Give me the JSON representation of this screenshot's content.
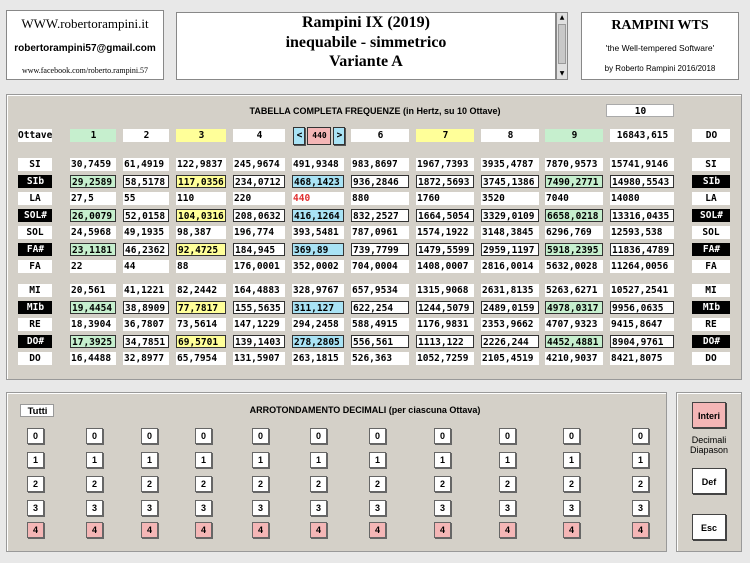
{
  "info": {
    "website": "WWW.robertorampini.it",
    "email": "robertorampini57@gmail.com",
    "facebook": "www.facebook.com/roberto.rampini.57"
  },
  "header": {
    "line1": "Rampini IX (2019)",
    "line2": "inequabile - simmetrico",
    "line3": "Variante A"
  },
  "wts": {
    "title": "RAMPINI WTS",
    "subtitle": "'the Well-tempered Software'",
    "author": "by Roberto Rampini 2016/2018"
  },
  "table": {
    "title": "TABELLA COMPLETA FREQUENZE (in Hertz, su 10 Ottave)",
    "octave_count": "10",
    "ottave_label": "Ottave",
    "octaves": [
      "1",
      "2",
      "3",
      "4",
      "",
      "6",
      "7",
      "8",
      "9"
    ],
    "diapason": {
      "left": "<",
      "value": "440",
      "right": ">"
    },
    "header_total": "16843,615",
    "header_note": "DO",
    "rows": [
      {
        "note": "SI",
        "style": "w",
        "values": [
          "30,7459",
          "61,4919",
          "122,9837",
          "245,9674",
          "491,9348",
          "983,8697",
          "1967,7393",
          "3935,4787",
          "7870,9573",
          "15741,9146"
        ]
      },
      {
        "note": "SIb",
        "style": "k",
        "values": [
          "29,2589",
          "58,5178",
          "117,0356",
          "234,0712",
          "468,1423",
          "936,2846",
          "1872,5693",
          "3745,1386",
          "7490,2771",
          "14980,5543"
        ]
      },
      {
        "note": "LA",
        "style": "w",
        "values": [
          "27,5",
          "55",
          "110",
          "220",
          "440",
          "880",
          "1760",
          "3520",
          "7040",
          "14080"
        ]
      },
      {
        "note": "SOL#",
        "style": "k",
        "values": [
          "26,0079",
          "52,0158",
          "104,0316",
          "208,0632",
          "416,1264",
          "832,2527",
          "1664,5054",
          "3329,0109",
          "6658,0218",
          "13316,0435"
        ]
      },
      {
        "note": "SOL",
        "style": "w",
        "values": [
          "24,5968",
          "49,1935",
          "98,387",
          "196,774",
          "393,5481",
          "787,0961",
          "1574,1922",
          "3148,3845",
          "6296,769",
          "12593,538"
        ]
      },
      {
        "note": "FA#",
        "style": "k",
        "values": [
          "23,1181",
          "46,2362",
          "92,4725",
          "184,945",
          "369,89",
          "739,7799",
          "1479,5599",
          "2959,1197",
          "5918,2395",
          "11836,4789"
        ]
      },
      {
        "note": "FA",
        "style": "w",
        "values": [
          "22",
          "44",
          "88",
          "176,0001",
          "352,0002",
          "704,0004",
          "1408,0007",
          "2816,0014",
          "5632,0028",
          "11264,0056"
        ]
      },
      {
        "note": "MI",
        "style": "w",
        "values": [
          "20,561",
          "41,1221",
          "82,2442",
          "164,4883",
          "328,9767",
          "657,9534",
          "1315,9068",
          "2631,8135",
          "5263,6271",
          "10527,2541"
        ]
      },
      {
        "note": "MIb",
        "style": "k",
        "values": [
          "19,4454",
          "38,8909",
          "77,7817",
          "155,5635",
          "311,127",
          "622,254",
          "1244,5079",
          "2489,0159",
          "4978,0317",
          "9956,0635"
        ]
      },
      {
        "note": "RE",
        "style": "w",
        "values": [
          "18,3904",
          "36,7807",
          "73,5614",
          "147,1229",
          "294,2458",
          "588,4915",
          "1176,9831",
          "2353,9662",
          "4707,9323",
          "9415,8647"
        ]
      },
      {
        "note": "DO#",
        "style": "k",
        "values": [
          "17,3925",
          "34,7851",
          "69,5701",
          "139,1403",
          "278,2805",
          "556,561",
          "1113,122",
          "2226,244",
          "4452,4881",
          "8904,9761"
        ]
      },
      {
        "note": "DO",
        "style": "w",
        "values": [
          "16,4488",
          "32,8977",
          "65,7954",
          "131,5907",
          "263,1815",
          "526,363",
          "1052,7259",
          "2105,4519",
          "4210,9037",
          "8421,8075"
        ]
      }
    ]
  },
  "rounding": {
    "all_label": "Tutti",
    "title": "ARROTONDAMENTO DECIMALI (per ciascuna Ottava)",
    "levels": [
      "0",
      "1",
      "2",
      "3",
      "4"
    ]
  },
  "right": {
    "interi": "Interi",
    "decimali": "Decimali",
    "diapason": "Diapason",
    "def": "Def",
    "esc": "Esc"
  },
  "colors": {
    "green": "#c6efce",
    "yellow": "#ffff99",
    "blue": "#a9e3f5",
    "pink": "#f4b6b6",
    "red_note": "#e03030"
  }
}
